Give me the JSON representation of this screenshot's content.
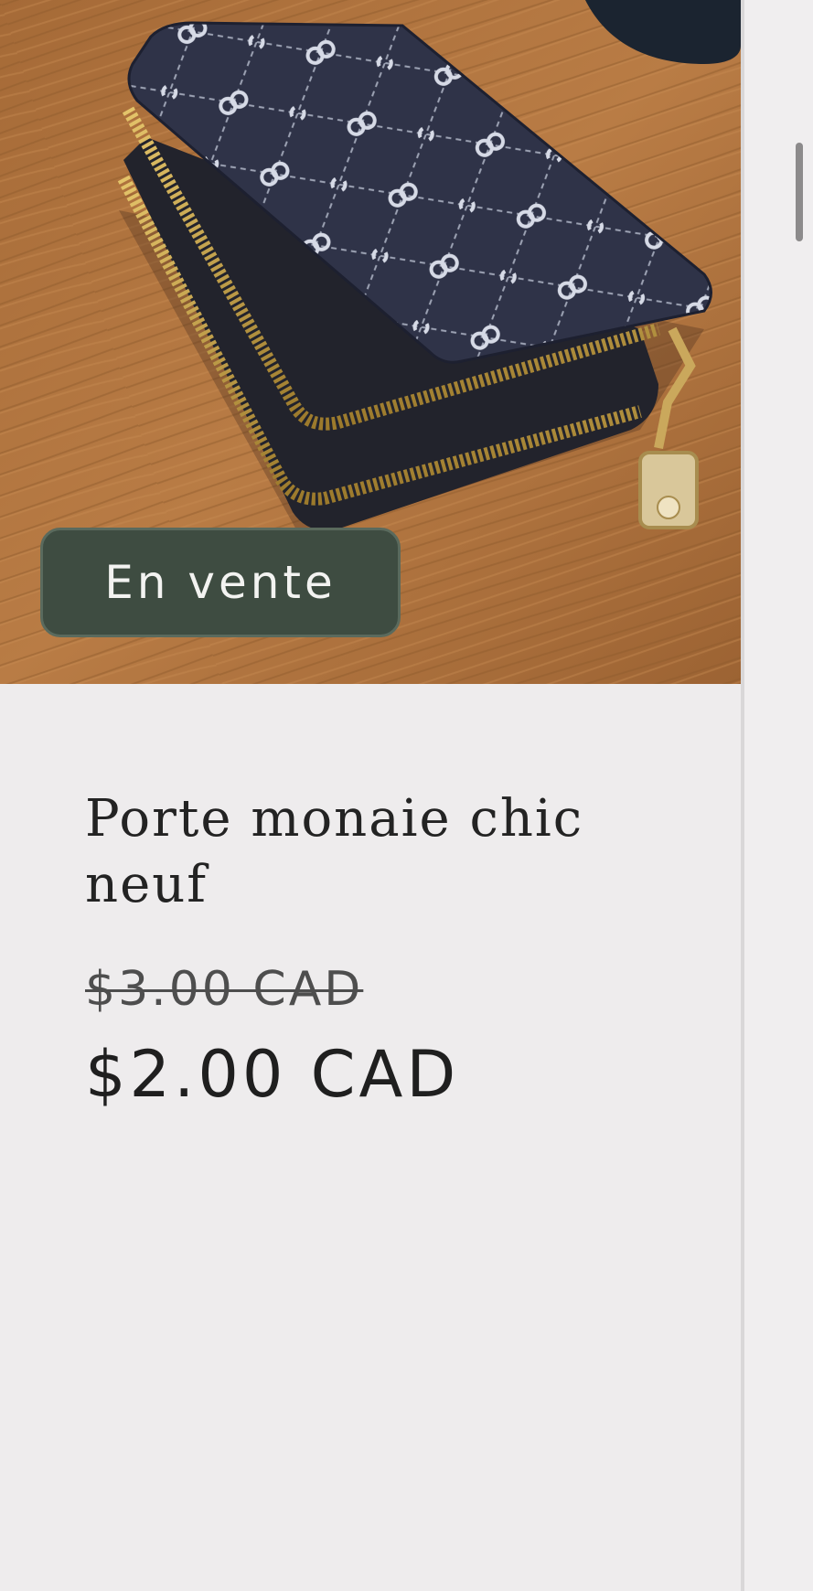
{
  "product": {
    "image_alt": "Porte-monnaie bleu marine à motif monogramme avec doubles fermetures éclair dorées",
    "badge": "En vente",
    "title": "Porte monaie chic neuf",
    "price_regular": "$3.00 CAD",
    "price_sale": "$2.00 CAD"
  },
  "colors": {
    "badge_bg": "#3e4c41",
    "page_bg": "#eeeced",
    "text": "#232323"
  }
}
